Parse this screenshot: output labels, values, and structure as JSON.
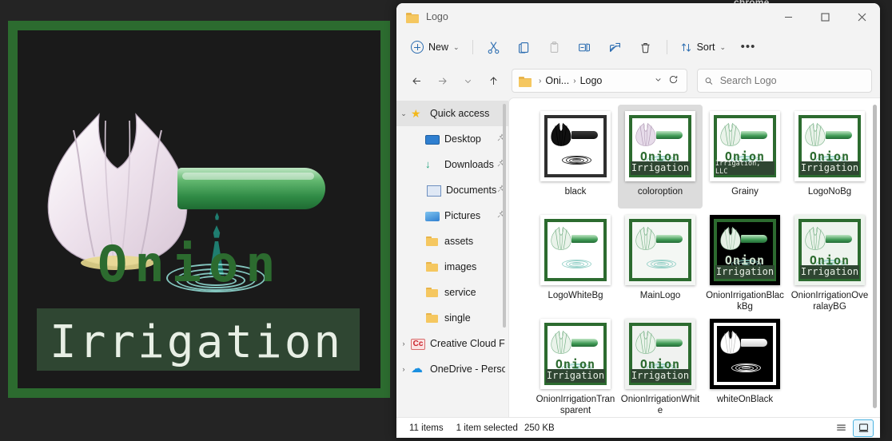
{
  "desktop": {
    "background_color": "#232323",
    "chrome_window_label": "chrome",
    "preview_image": {
      "name": "onion-irrigation-logo-preview",
      "brand_word_top": "Onion",
      "brand_word_bottom": "Irrigation",
      "frame_color": "#2c6b2f",
      "band_color": "#2f4632",
      "canvas_color": "#1a1a1a"
    }
  },
  "window": {
    "title": "Logo",
    "title_icon": "folder-icon",
    "controls": {
      "minimize": "minimize-icon",
      "maximize": "maximize-icon",
      "close": "close-icon"
    }
  },
  "toolbar": {
    "new_label": "New",
    "new_icon": "plus-circle-icon",
    "cut_icon": "scissors-icon",
    "copy_icon": "copy-icon",
    "paste_icon": "paste-icon",
    "rename_icon": "rename-icon",
    "share_icon": "share-icon",
    "delete_icon": "trash-icon",
    "sort_label": "Sort",
    "sort_icon": "sort-arrows-icon",
    "more_label": "•••",
    "chevron": "⌄"
  },
  "address": {
    "back_icon": "arrow-left-icon",
    "forward_icon": "arrow-right-icon",
    "recent_icon": "chevron-down-icon",
    "up_icon": "arrow-up-icon",
    "folder_icon": "folder-icon",
    "crumbs": [
      "Oni...",
      "Logo"
    ],
    "crumb_separator": "›",
    "dropdown_icon": "chevron-down-icon",
    "refresh_icon": "refresh-icon"
  },
  "search": {
    "placeholder": "Search Logo",
    "value": "",
    "icon": "search-icon"
  },
  "sidebar": {
    "items": [
      {
        "label": "Quick access",
        "icon": "star-icon",
        "expander": "⌄",
        "level": 0,
        "selected": true,
        "pinned": false
      },
      {
        "label": "Desktop",
        "icon": "desktop-icon",
        "expander": "",
        "level": 1,
        "selected": false,
        "pinned": true
      },
      {
        "label": "Downloads",
        "icon": "download-icon",
        "expander": "",
        "level": 1,
        "selected": false,
        "pinned": true
      },
      {
        "label": "Documents",
        "icon": "documents-icon",
        "expander": "",
        "level": 1,
        "selected": false,
        "pinned": true
      },
      {
        "label": "Pictures",
        "icon": "pictures-icon",
        "expander": "",
        "level": 1,
        "selected": false,
        "pinned": true
      },
      {
        "label": "assets",
        "icon": "folder-icon",
        "expander": "",
        "level": 1,
        "selected": false,
        "pinned": false
      },
      {
        "label": "images",
        "icon": "folder-icon",
        "expander": "",
        "level": 1,
        "selected": false,
        "pinned": false
      },
      {
        "label": "service",
        "icon": "folder-icon",
        "expander": "",
        "level": 1,
        "selected": false,
        "pinned": false
      },
      {
        "label": "single",
        "icon": "folder-icon",
        "expander": "",
        "level": 1,
        "selected": false,
        "pinned": false
      },
      {
        "label": "Creative Cloud F",
        "icon": "creative-cloud-icon",
        "expander": "›",
        "level": 0,
        "selected": false,
        "pinned": false
      },
      {
        "label": "OneDrive - Perso",
        "icon": "onedrive-icon",
        "expander": "›",
        "level": 0,
        "selected": false,
        "pinned": false
      }
    ],
    "pin_glyph": "📌"
  },
  "files": [
    {
      "name": "black",
      "style": "black",
      "selected": false
    },
    {
      "name": "coloroption",
      "style": "color",
      "selected": true
    },
    {
      "name": "Grainy",
      "style": "grainy",
      "selected": false
    },
    {
      "name": "LogoNoBg",
      "style": "nobg",
      "selected": false
    },
    {
      "name": "LogoWhiteBg",
      "style": "whitebg",
      "selected": false
    },
    {
      "name": "MainLogo",
      "style": "mainlogo",
      "selected": false
    },
    {
      "name": "OnionIrrigationBlackBg",
      "style": "blackbg",
      "selected": false
    },
    {
      "name": "OnionIrrigationOveralayBG",
      "style": "overlaybg",
      "selected": false
    },
    {
      "name": "OnionIrrigationTransparent",
      "style": "transparent",
      "selected": false
    },
    {
      "name": "OnionIrrigationWhite",
      "style": "white",
      "selected": false
    },
    {
      "name": "whiteOnBlack",
      "style": "wob",
      "selected": false
    }
  ],
  "thumb_text": {
    "onion": "Onion",
    "irrigation": "Irrigation",
    "irrigation_llc": "Irrigation, LLC"
  },
  "statusbar": {
    "item_count": "11 items",
    "selection": "1 item selected",
    "size": "250 KB",
    "details_view_icon": "list-view-icon",
    "large_icons_view_icon": "large-icons-view-icon"
  },
  "colors": {
    "brand_green": "#2c6b2f",
    "band_green": "#2f4632",
    "accent_blue": "#2b6cb0",
    "selection_gray": "#dcdcdc"
  }
}
